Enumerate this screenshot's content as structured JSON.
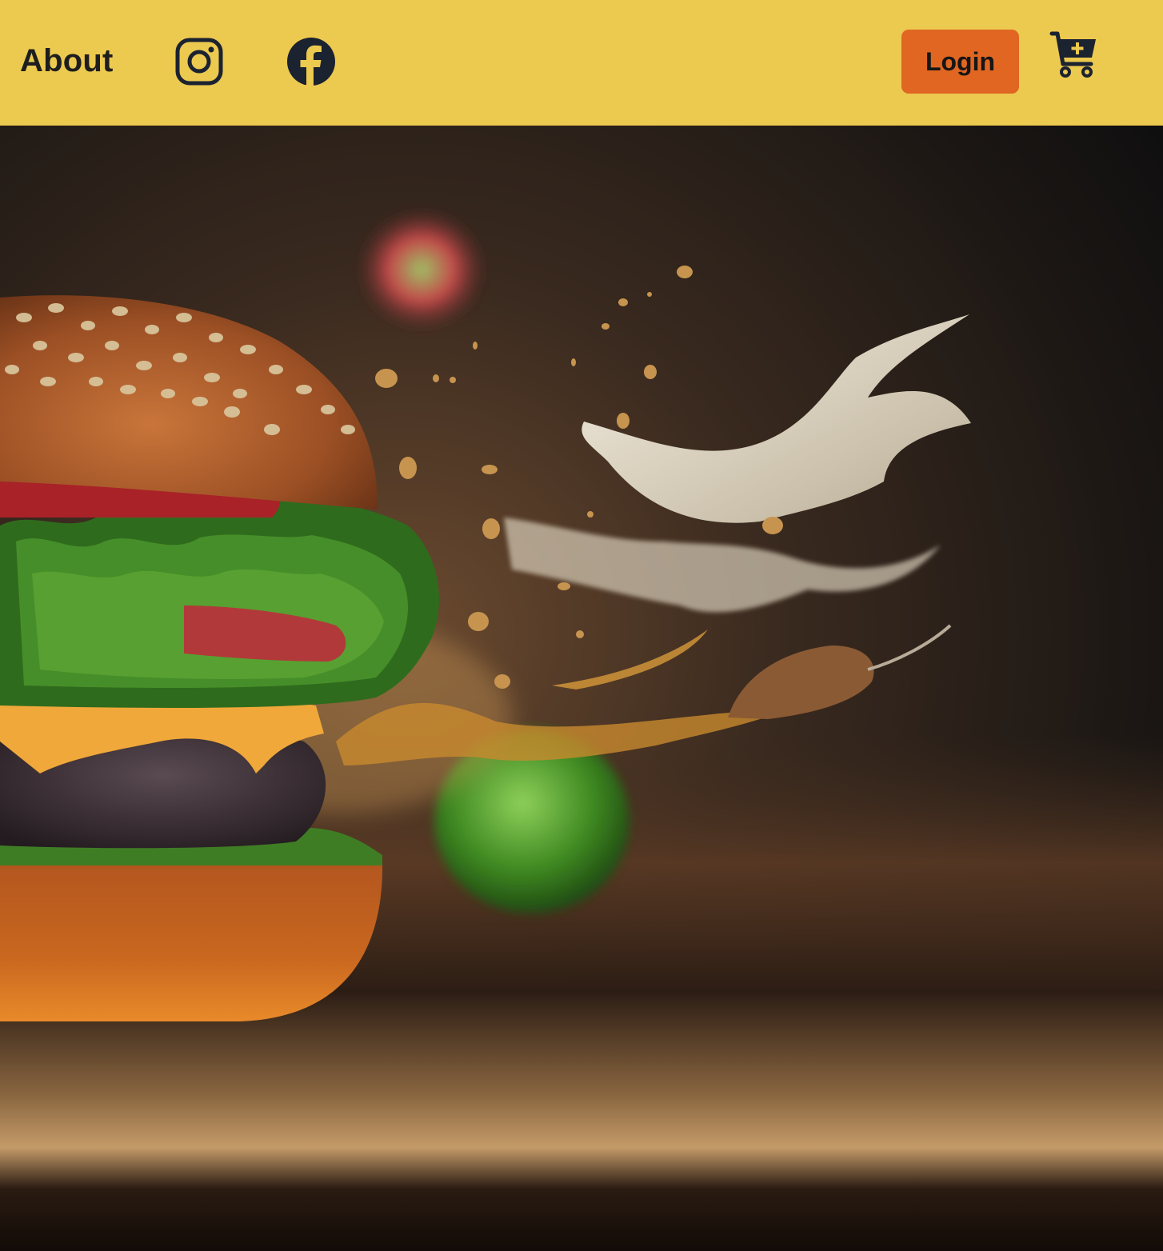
{
  "navbar": {
    "background_color": "#ecc94f",
    "about_label": "About",
    "instagram_icon": "instagram-icon",
    "facebook_icon": "facebook-icon",
    "login_label": "Login",
    "login_color": "#e06622",
    "cart_icon": "add-to-cart-icon"
  },
  "hero": {
    "image": "burger-explosion-photo"
  }
}
